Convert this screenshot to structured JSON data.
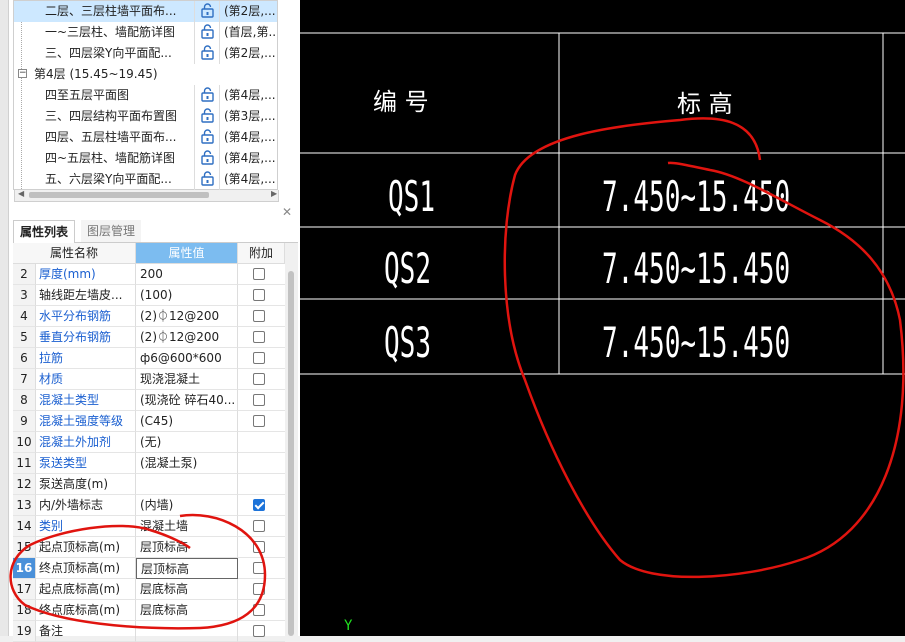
{
  "tree": {
    "rows": [
      {
        "name": "二层、三层柱墙平面布...",
        "floor": "(第2层,...",
        "selected": true
      },
      {
        "name": "一~三层柱、墙配筋详图",
        "floor": "(首层,第...",
        "selected": false
      },
      {
        "name": "三、四层梁Y向平面配...",
        "floor": "(第2层,...",
        "selected": false
      }
    ],
    "floor_group": {
      "label": "第4层 (15.45~19.45)",
      "toggle": "−"
    },
    "rows2": [
      {
        "name": "四至五层平面图",
        "floor": "(第4层,..."
      },
      {
        "name": "三、四层结构平面布置图",
        "floor": "(第3层,..."
      },
      {
        "name": "四层、五层柱墙平面布...",
        "floor": "(第4层,..."
      },
      {
        "name": "四~五层柱、墙配筋详图",
        "floor": "(第4层,..."
      },
      {
        "name": "五、六层梁Y向平面配...",
        "floor": "(第4层,..."
      }
    ]
  },
  "tabs": {
    "properties": "属性列表",
    "layers": "图层管理"
  },
  "grid": {
    "headers": {
      "name": "属性名称",
      "value": "属性值",
      "extra": "附加"
    },
    "rows": [
      {
        "num": "2",
        "name": "厚度(mm)",
        "value": "200",
        "blue": true,
        "checkbox": true,
        "checked": false
      },
      {
        "num": "3",
        "name": "轴线距左墙皮...",
        "value": "(100)",
        "blue": false,
        "checkbox": true,
        "checked": false
      },
      {
        "num": "4",
        "name": "水平分布钢筋",
        "value": "(2)⏀12@200",
        "blue": true,
        "checkbox": true,
        "checked": false
      },
      {
        "num": "5",
        "name": "垂直分布钢筋",
        "value": "(2)⏀12@200",
        "blue": true,
        "checkbox": true,
        "checked": false
      },
      {
        "num": "6",
        "name": "拉筋",
        "value": "ф6@600*600",
        "blue": true,
        "checkbox": true,
        "checked": false
      },
      {
        "num": "7",
        "name": "材质",
        "value": "现浇混凝土",
        "blue": true,
        "checkbox": true,
        "checked": false
      },
      {
        "num": "8",
        "name": "混凝土类型",
        "value": "(现浇砼 碎石40...",
        "blue": true,
        "checkbox": true,
        "checked": false
      },
      {
        "num": "9",
        "name": "混凝土强度等级",
        "value": "(C45)",
        "blue": true,
        "checkbox": true,
        "checked": false
      },
      {
        "num": "10",
        "name": "混凝土外加剂",
        "value": "(无)",
        "blue": true,
        "checkbox": false,
        "checked": false
      },
      {
        "num": "11",
        "name": "泵送类型",
        "value": "(混凝土泵)",
        "blue": true,
        "checkbox": false,
        "checked": false
      },
      {
        "num": "12",
        "name": "泵送高度(m)",
        "value": "",
        "blue": false,
        "checkbox": false,
        "checked": false
      },
      {
        "num": "13",
        "name": "内/外墙标志",
        "value": "(内墙)",
        "blue": false,
        "checkbox": true,
        "checked": true
      },
      {
        "num": "14",
        "name": "类别",
        "value": "混凝土墙",
        "blue": true,
        "checkbox": true,
        "checked": false
      },
      {
        "num": "15",
        "name": "起点顶标高(m)",
        "value": "层顶标高",
        "blue": false,
        "checkbox": true,
        "checked": false
      },
      {
        "num": "16",
        "name": "终点顶标高(m)",
        "value": "层顶标高",
        "blue": false,
        "checkbox": true,
        "checked": false,
        "current": true
      },
      {
        "num": "17",
        "name": "起点底标高(m)",
        "value": "层底标高",
        "blue": false,
        "checkbox": true,
        "checked": false
      },
      {
        "num": "18",
        "name": "终点底标高(m)",
        "value": "层底标高",
        "blue": false,
        "checkbox": true,
        "checked": false
      },
      {
        "num": "19",
        "name": "备注",
        "value": "",
        "blue": false,
        "checkbox": true,
        "checked": false
      }
    ]
  },
  "cad": {
    "header_number": "编  号",
    "header_elevation": "标  高",
    "rows": [
      {
        "id": "QS1",
        "elevation": "7.450~15.450"
      },
      {
        "id": "QS2",
        "elevation": "7.450~15.450"
      },
      {
        "id": "QS3",
        "elevation": "7.450~15.450"
      }
    ],
    "axis_label": "Y"
  },
  "colors": {
    "annotation": "#e0140f",
    "cad_bg": "#000000",
    "selection": "#cde8ff",
    "link_blue": "#1a5fd0"
  },
  "icons": {
    "lock": "lock-icon",
    "collapse": "collapse-icon",
    "close": "close-icon"
  }
}
